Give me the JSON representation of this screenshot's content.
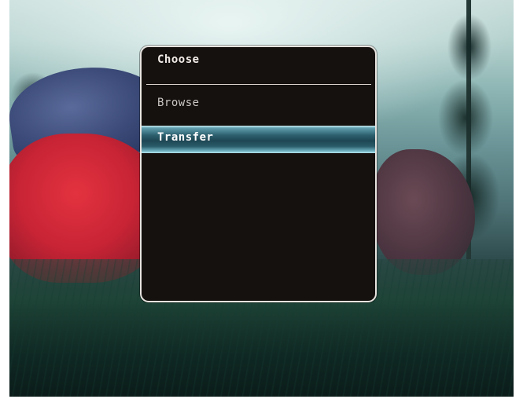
{
  "menu": {
    "title": "Choose",
    "items": [
      {
        "label": "Browse",
        "selected": false
      },
      {
        "label": "Transfer",
        "selected": true
      }
    ]
  },
  "colors": {
    "menu_background": "#14110f",
    "menu_border": "#e7e3df",
    "selected_highlight": "#2c5f6d",
    "text": "#f3ece7"
  }
}
